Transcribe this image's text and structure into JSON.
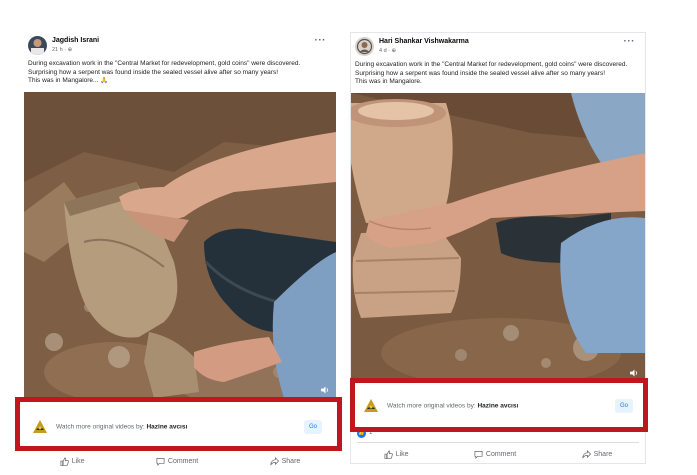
{
  "posts": [
    {
      "author": "Jagdish Israni",
      "meta": "21 h · ⊕",
      "more": "···",
      "text_lines": [
        "During excavation work in the \"Central Market for redevelopment, gold coins\" were discovered.",
        "Surprising how a serpent was found inside the sealed vessel alive after so many years!",
        "This was in Mangalore... 🙏"
      ],
      "promo": {
        "prefix": "Watch more original videos by:",
        "channel": "Hazine avcısı",
        "go_label": "Go"
      },
      "actions": {
        "like": "Like",
        "comment": "Comment",
        "share": "Share"
      }
    },
    {
      "author": "Hari Shankar Vishwakarma",
      "meta": "4 d · ⊕",
      "more": "···",
      "text_lines": [
        "During excavation work in the \"Central Market for redevelopment, gold coins\" were discovered.",
        "Surprising how a serpent was found inside the sealed vessel alive after so many years!",
        "This was in Mangalore."
      ],
      "promo": {
        "prefix": "Watch more original videos by:",
        "channel": "Hazine avcısı",
        "go_label": "Go"
      },
      "reactions": {
        "count": "1"
      },
      "actions": {
        "like": "Like",
        "comment": "Comment",
        "share": "Share"
      }
    }
  ],
  "colors": {
    "highlight": "#c0171d",
    "link_blue": "#1877f2",
    "soil": "#8a6a4e"
  },
  "icons": [
    "globe-icon",
    "more-icon",
    "volume-icon",
    "like-icon",
    "comment-icon",
    "share-icon",
    "channel-logo-icon"
  ]
}
